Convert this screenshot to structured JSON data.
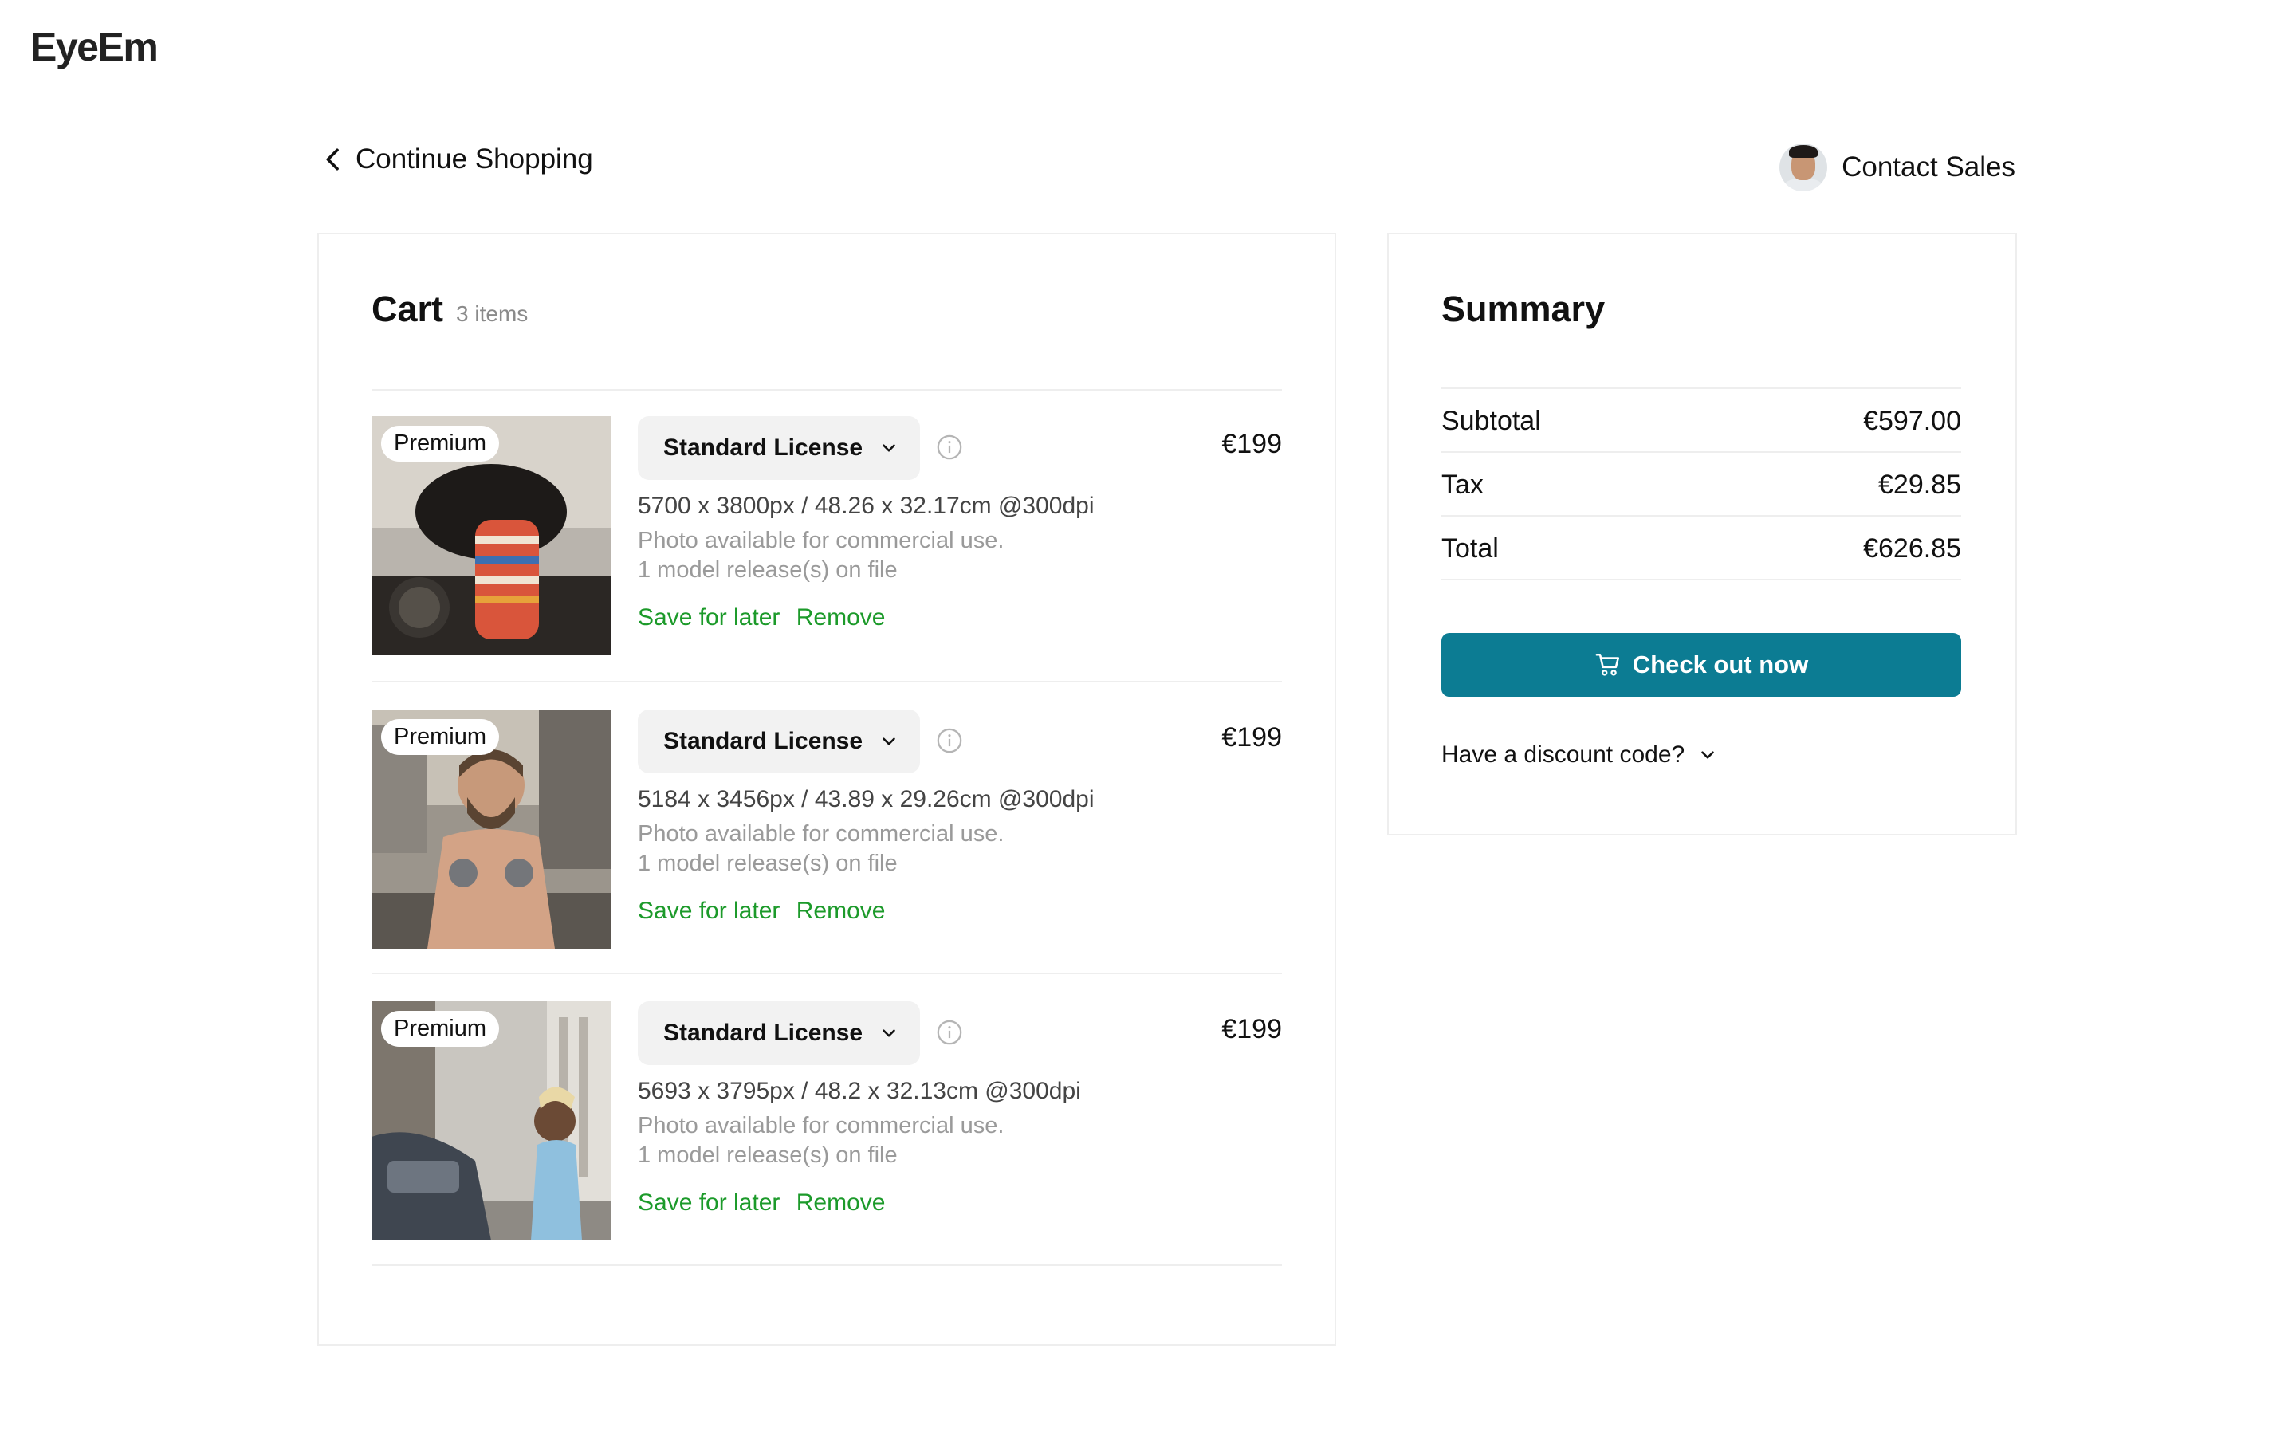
{
  "app": {
    "logo": "EyeEm"
  },
  "topbar": {
    "continue_label": "Continue Shopping",
    "contact_label": "Contact Sales"
  },
  "cart": {
    "title": "Cart",
    "count_label": "3 items",
    "items": [
      {
        "badge": "Premium",
        "license": "Standard License",
        "price": "€199",
        "dims": "5700 x 3800px / 48.26 x 32.17cm @300dpi",
        "desc1": "Photo available for commercial use.",
        "desc2": "1 model release(s) on file",
        "save_label": "Save for later",
        "remove_label": "Remove"
      },
      {
        "badge": "Premium",
        "license": "Standard License",
        "price": "€199",
        "dims": "5184 x 3456px / 43.89 x 29.26cm @300dpi",
        "desc1": "Photo available for commercial use.",
        "desc2": "1 model release(s) on file",
        "save_label": "Save for later",
        "remove_label": "Remove"
      },
      {
        "badge": "Premium",
        "license": "Standard License",
        "price": "€199",
        "dims": "5693 x 3795px / 48.2 x 32.13cm @300dpi",
        "desc1": "Photo available for commercial use.",
        "desc2": "1 model release(s) on file",
        "save_label": "Save for later",
        "remove_label": "Remove"
      }
    ]
  },
  "summary": {
    "title": "Summary",
    "rows": [
      {
        "label": "Subtotal",
        "value": "€597.00"
      },
      {
        "label": "Tax",
        "value": "€29.85"
      },
      {
        "label": "Total",
        "value": "€626.85"
      }
    ],
    "checkout_label": "Check out now",
    "discount_label": "Have a discount code?"
  },
  "colors": {
    "accent": "#0c7c93",
    "link_green": "#1c9a2a",
    "muted_text": "#9a9a9a",
    "divider": "#eeeeee"
  },
  "icons": [
    "chevron-left-icon",
    "chevron-down-icon",
    "info-icon",
    "cart-icon",
    "avatar"
  ]
}
